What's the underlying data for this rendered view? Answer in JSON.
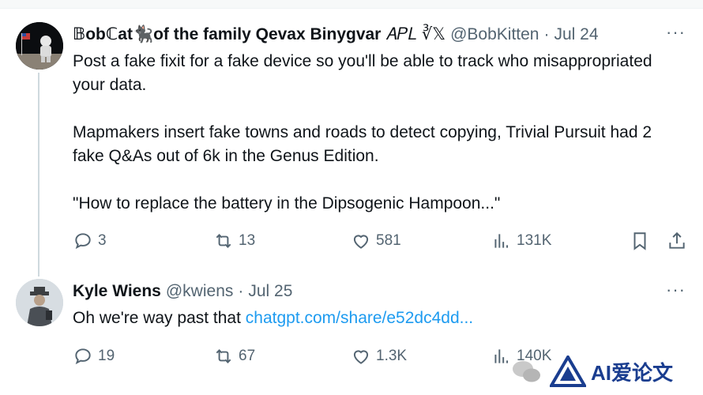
{
  "tweets": [
    {
      "display_name": "𝔹obℂat🐈‍⬛of the family Qevax Binygvar",
      "name_badge": "𝐴𝑃𝐿 ∛𝕏",
      "handle": "@BobKitten",
      "separator": "·",
      "date": "Jul 24",
      "more": "···",
      "paragraphs": [
        "Post a fake fixit for a fake device so you'll be able to track who misappropriated your data.",
        "Mapmakers insert fake towns and roads to detect copying, Trivial Pursuit had 2 fake Q&As out of 6k in the Genus Edition.",
        "\"How to replace the battery in the Dipsogenic Hampoon...\""
      ],
      "stats": {
        "replies": "3",
        "reposts": "13",
        "likes": "581",
        "views": "131K"
      }
    },
    {
      "display_name": "Kyle Wiens",
      "handle": "@kwiens",
      "separator": "·",
      "date": "Jul 25",
      "more": "···",
      "text": "Oh we're way past that ",
      "link": "chatgpt.com/share/e52dc4dd...",
      "stats": {
        "replies": "19",
        "reposts": "67",
        "likes": "1.3K",
        "views": "140K"
      }
    }
  ],
  "watermark": {
    "text": "AI爱论文"
  },
  "colors": {
    "accent": "#1d9bf0",
    "muted": "#536471",
    "thread_line": "#cfd9de"
  }
}
